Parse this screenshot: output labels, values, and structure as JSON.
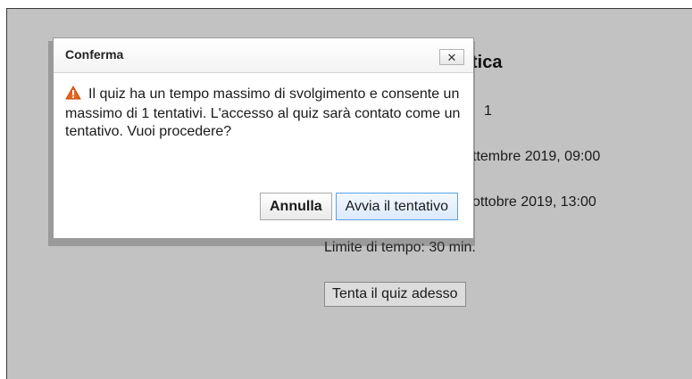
{
  "page": {
    "title_visible": "tica",
    "line_attempts_fragment": "1",
    "line_open_fragment": "ttembre 2019, 09:00",
    "line_close_fragment": "ottobre 2019, 13:00",
    "line_timelimit_fragment": "Limite di tempo: 30 min.",
    "attempt_button": "Tenta il quiz adesso"
  },
  "dialog": {
    "title": "Conferma",
    "close_symbol": "✕",
    "message": "Il quiz ha un tempo massimo di svolgimento e consente un massimo di 1 tentativi. L'accesso al quiz sarà contato come un tentativo. Vuoi procedere?",
    "cancel_label": "Annulla",
    "start_label": "Avvia il tentativo",
    "icon": "warning-icon",
    "colors": {
      "warning": "#e8641a",
      "start_border": "#5aa0e6"
    }
  },
  "colors": {
    "overlay_background": "#c2c2c2"
  }
}
